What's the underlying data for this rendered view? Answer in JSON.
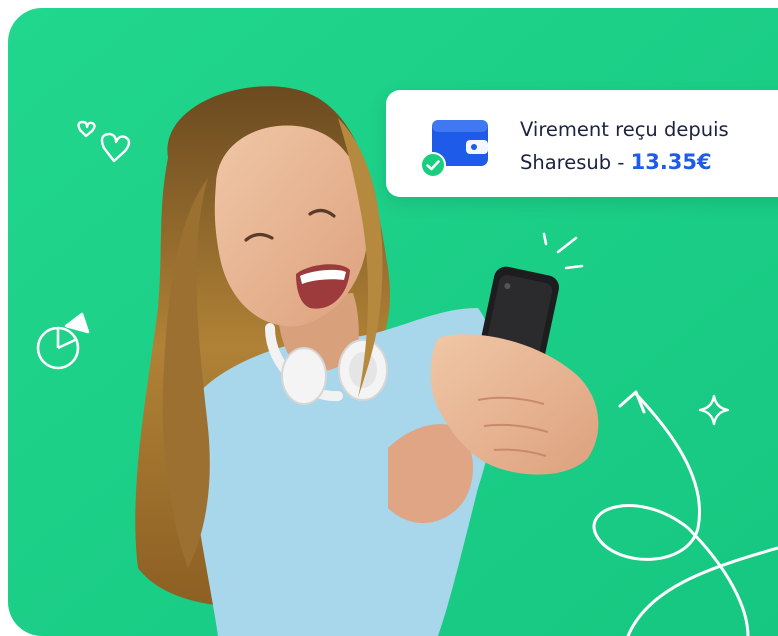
{
  "colors": {
    "background": "#1fd48b",
    "background_dark": "#17c784",
    "accent_blue": "#1d5be8",
    "check_green": "#18cf7f",
    "doodle_white": "#ffffff"
  },
  "scene": {
    "photo": "woman-smiling-at-phone",
    "doodles": [
      "heart-icon",
      "pie-chart-icon",
      "sparkle-lines-icon",
      "curved-arrow-icon",
      "star-sparkle-icon"
    ]
  },
  "notification": {
    "icon": "wallet-icon",
    "status_icon": "check-circle-icon",
    "line1": "Virement reçu depuis",
    "line2_prefix": "Sharesub - ",
    "amount": "13.35€"
  }
}
